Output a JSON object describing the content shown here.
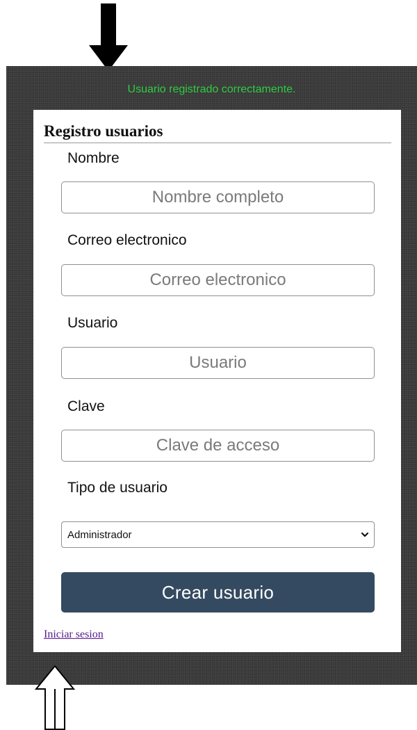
{
  "status": {
    "success_message": "Usuario registrado correctamente."
  },
  "form": {
    "title": "Registro usuarios",
    "fields": {
      "nombre": {
        "label": "Nombre",
        "placeholder": "Nombre completo",
        "value": ""
      },
      "correo": {
        "label": "Correo electronico",
        "placeholder": "Correo electronico",
        "value": ""
      },
      "usuario": {
        "label": "Usuario",
        "placeholder": "Usuario",
        "value": ""
      },
      "clave": {
        "label": "Clave",
        "placeholder": "Clave de acceso",
        "value": ""
      },
      "tipo": {
        "label": "Tipo de usuario",
        "selected": "Administrador"
      }
    },
    "submit_label": "Crear usuario",
    "login_link": "Iniciar sesion"
  },
  "colors": {
    "success": "#2ecc40",
    "button_bg": "#344a60",
    "link": "#551a8b",
    "panel_bg": "#3a3a3a"
  },
  "icons": {
    "top_arrow": "arrow-down-icon",
    "bottom_arrow": "arrow-up-icon",
    "select_chevron": "chevron-down-icon"
  }
}
